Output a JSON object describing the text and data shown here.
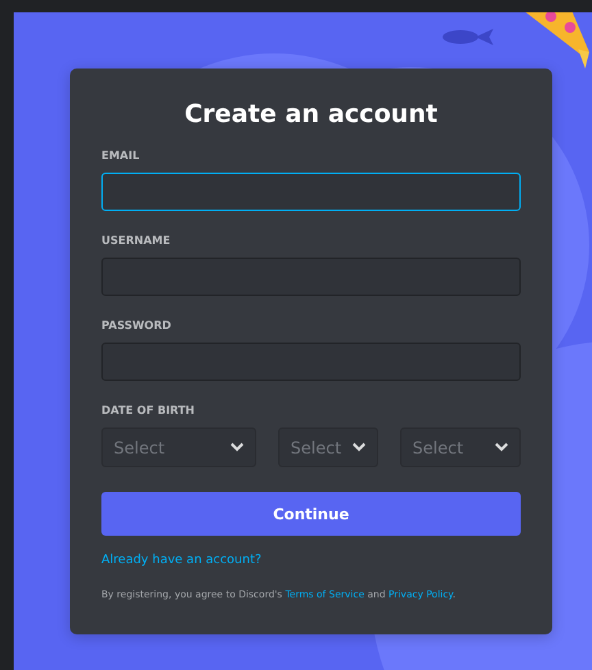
{
  "title": "Create an account",
  "fields": [
    {
      "label": "EMAIL",
      "focused": true
    },
    {
      "label": "USERNAME",
      "focused": false
    },
    {
      "label": "PASSWORD",
      "focused": false
    }
  ],
  "date_of_birth": {
    "label": "DATE OF BIRTH",
    "selects": [
      {
        "placeholder": "Select"
      },
      {
        "placeholder": "Select"
      },
      {
        "placeholder": "Select"
      }
    ]
  },
  "continue_button": "Continue",
  "login_link": "Already have an account?",
  "legal": [
    {
      "kind": "text",
      "text": "By registering, you agree to Discord's "
    },
    {
      "kind": "link",
      "text": "Terms of Service"
    },
    {
      "kind": "text",
      "text": " and "
    },
    {
      "kind": "link",
      "text": "Privacy Policy"
    },
    {
      "kind": "text",
      "text": "."
    }
  ]
}
